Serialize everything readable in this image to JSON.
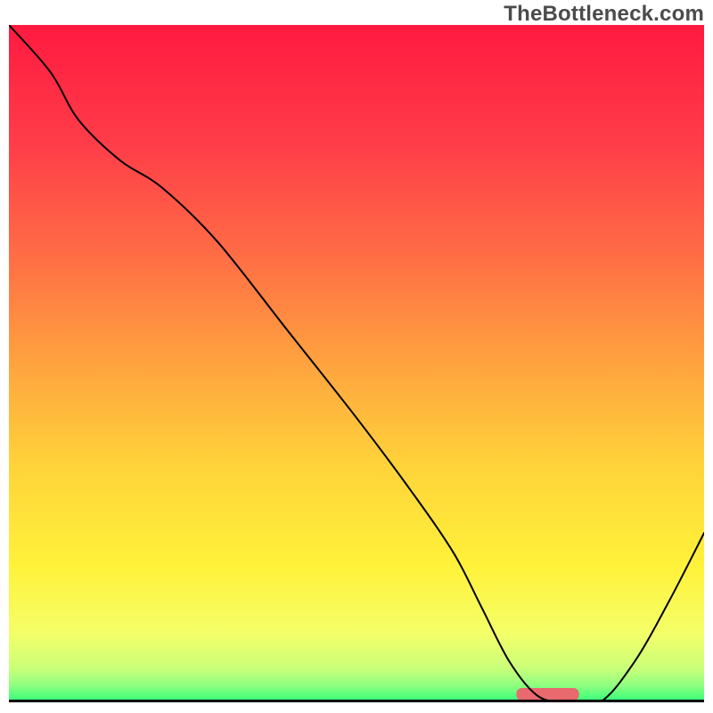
{
  "watermark": "TheBottleneck.com",
  "chart_data": {
    "type": "line",
    "title": "",
    "xlabel": "",
    "ylabel": "",
    "xlim": [
      0,
      100
    ],
    "ylim": [
      0,
      100
    ],
    "grid": false,
    "legend": false,
    "series": [
      {
        "name": "bottleneck-curve",
        "x": [
          0,
          6,
          10,
          16,
          22,
          30,
          40,
          50,
          58,
          64,
          68,
          72,
          76,
          80,
          85,
          90,
          95,
          100
        ],
        "y": [
          100,
          93,
          86,
          80,
          76,
          68,
          55,
          42,
          31,
          22,
          14,
          6,
          1,
          0,
          0,
          6,
          15,
          25
        ]
      }
    ],
    "annotations": [
      {
        "name": "optimal-marker",
        "type": "bar",
        "x_start": 73,
        "x_end": 82,
        "y": 0
      }
    ],
    "gradient_stops": [
      {
        "pos": 0.0,
        "color": "#ff1a40"
      },
      {
        "pos": 0.18,
        "color": "#ff3e49"
      },
      {
        "pos": 0.35,
        "color": "#ff7045"
      },
      {
        "pos": 0.5,
        "color": "#ffa33f"
      },
      {
        "pos": 0.65,
        "color": "#ffd33a"
      },
      {
        "pos": 0.8,
        "color": "#fff23a"
      },
      {
        "pos": 0.9,
        "color": "#f4ff6a"
      },
      {
        "pos": 0.95,
        "color": "#c9ff79"
      },
      {
        "pos": 0.975,
        "color": "#8fff80"
      },
      {
        "pos": 1.0,
        "color": "#2eff7a"
      }
    ]
  }
}
